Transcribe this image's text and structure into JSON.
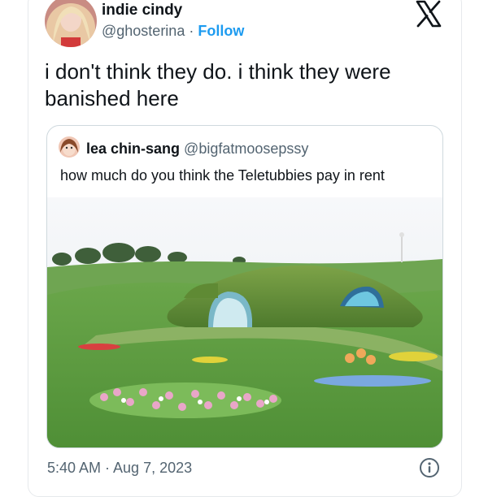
{
  "tweet": {
    "display_name": "indie cindy",
    "handle": "@ghosterina",
    "separator": "·",
    "follow_label": "Follow",
    "text": "i don't think they do. i think they were banished here",
    "timestamp": "5:40 AM · Aug 7, 2023"
  },
  "quoted_tweet": {
    "display_name": "lea chin-sang",
    "handle": "@bigfatmoosepssy",
    "text": "how much do you think the Teletubbies pay in rent"
  },
  "icons": {
    "brand": "x-logo-icon",
    "info": "info-icon"
  },
  "colors": {
    "follow": "#1d9bf0",
    "secondary_text": "#536471",
    "primary_text": "#0f1419",
    "border": "#cfd9de"
  }
}
